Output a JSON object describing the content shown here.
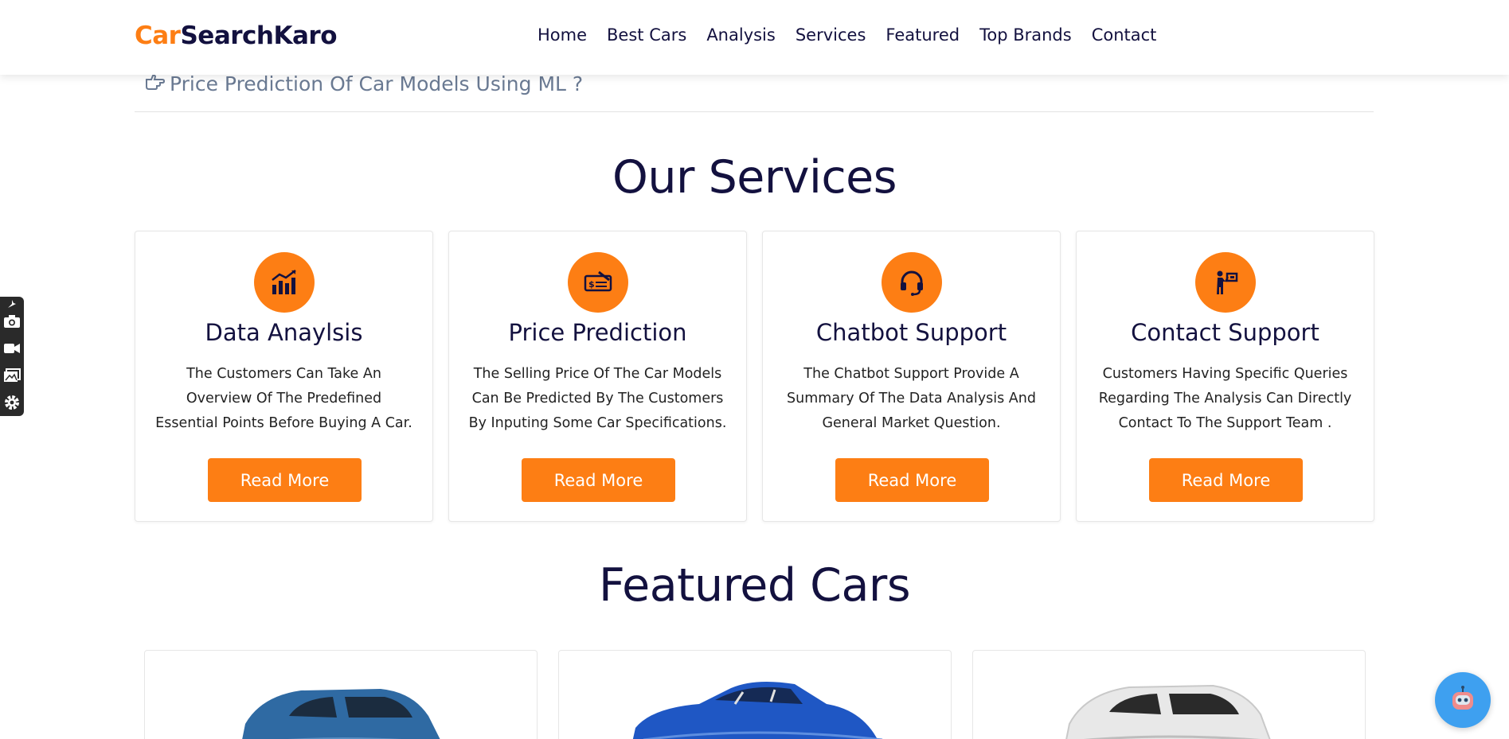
{
  "header": {
    "logo_part1": "Car",
    "logo_part2": "SearchKaro",
    "nav": [
      "Home",
      "Best Cars",
      "Analysis",
      "Services",
      "Featured",
      "Top Brands",
      "Contact"
    ]
  },
  "prediction_link": {
    "text": "Price Prediction Of Car Models Using ML ?",
    "icon": "hand-pointing-icon"
  },
  "services": {
    "heading_part1": "Our",
    "heading_part2": "Services",
    "cards": [
      {
        "icon": "chart-icon",
        "title": "Data Anaylsis",
        "desc": "The Customers Can Take An Overview Of The Predefined Essential Points Before Buying A Car.",
        "button": "Read More"
      },
      {
        "icon": "price-tag-icon",
        "title": "Price Prediction",
        "desc": "The Selling Price Of The Car Models Can Be Predicted By The Customers By Inputing Some Car Specifications.",
        "button": "Read More"
      },
      {
        "icon": "headset-icon",
        "title": "Chatbot Support",
        "desc": "The Chatbot Support Provide A Summary Of The Data Analysis And General Market Question.",
        "button": "Read More"
      },
      {
        "icon": "person-sign-icon",
        "title": "Contact Support",
        "desc": "Customers Having Specific Queries Regarding The Analysis Can Directly Contact To The Support Team .",
        "button": "Read More"
      }
    ]
  },
  "featured": {
    "heading_part1": "Featured",
    "heading_part2": "Cars",
    "cars": [
      {
        "color": "#2f6aa3",
        "type": "suv"
      },
      {
        "color": "#1f57c4",
        "type": "convertible"
      },
      {
        "color": "#e8e8e8",
        "type": "suv"
      }
    ]
  },
  "colors": {
    "accent": "#fd7e14",
    "navy": "#13113f",
    "chat_bubble": "#3ea0f0"
  },
  "toolstrip_icons": [
    "pin-icon",
    "camera-icon",
    "video-icon",
    "gallery-icon",
    "gear-icon"
  ],
  "chat_icon": "robot-icon"
}
